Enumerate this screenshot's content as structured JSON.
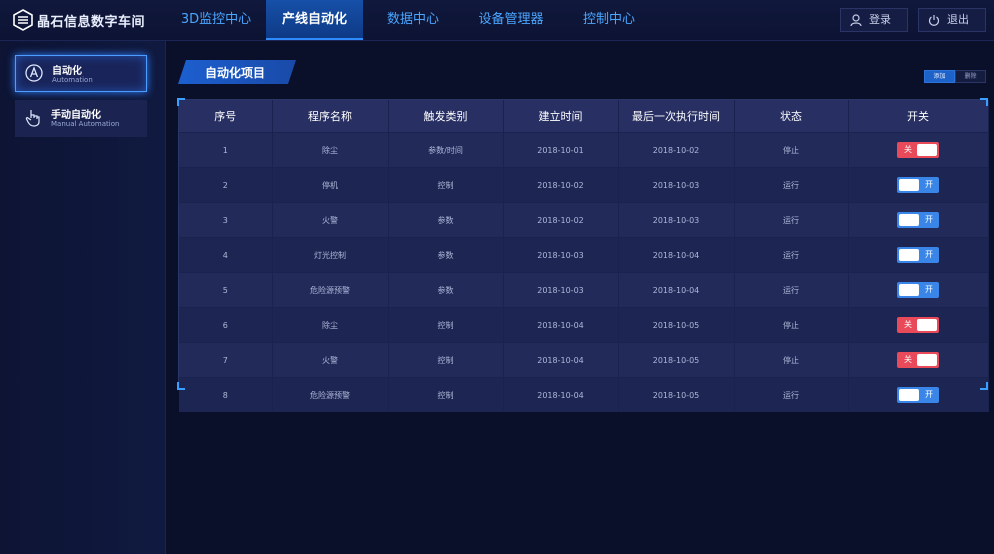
{
  "app": {
    "title": "晶石信息数字车间"
  },
  "nav": {
    "tabs": [
      {
        "label": "3D监控中心"
      },
      {
        "label": "产线自动化"
      },
      {
        "label": "数据中心"
      },
      {
        "label": "设备管理器"
      },
      {
        "label": "控制中心"
      }
    ],
    "active_index": 1
  },
  "header": {
    "login_label": "登录",
    "logout_label": "退出"
  },
  "sidebar": {
    "items": [
      {
        "title": "自动化",
        "subtitle": "Automation",
        "active": true
      },
      {
        "title": "手动自动化",
        "subtitle": "Manual Automation",
        "active": false
      }
    ]
  },
  "main": {
    "section_title": "自动化项目",
    "add_label": "添加",
    "delete_label": "删除",
    "columns": [
      "序号",
      "程序名称",
      "触发类别",
      "建立时间",
      "最后一次执行时间",
      "状态",
      "开关"
    ],
    "rows": [
      {
        "no": "1",
        "name": "除尘",
        "trigger": "参数/时间",
        "created": "2018-10-01",
        "last_run": "2018-10-02",
        "status": "停止",
        "switch": "关",
        "on": false
      },
      {
        "no": "2",
        "name": "停机",
        "trigger": "控制",
        "created": "2018-10-02",
        "last_run": "2018-10-03",
        "status": "运行",
        "switch": "开",
        "on": true
      },
      {
        "no": "3",
        "name": "火警",
        "trigger": "参数",
        "created": "2018-10-02",
        "last_run": "2018-10-03",
        "status": "运行",
        "switch": "开",
        "on": true
      },
      {
        "no": "4",
        "name": "灯光控制",
        "trigger": "参数",
        "created": "2018-10-03",
        "last_run": "2018-10-04",
        "status": "运行",
        "switch": "开",
        "on": true
      },
      {
        "no": "5",
        "name": "危险源预警",
        "trigger": "参数",
        "created": "2018-10-03",
        "last_run": "2018-10-04",
        "status": "运行",
        "switch": "开",
        "on": true
      },
      {
        "no": "6",
        "name": "除尘",
        "trigger": "控制",
        "created": "2018-10-04",
        "last_run": "2018-10-05",
        "status": "停止",
        "switch": "关",
        "on": false
      },
      {
        "no": "7",
        "name": "火警",
        "trigger": "控制",
        "created": "2018-10-04",
        "last_run": "2018-10-05",
        "status": "停止",
        "switch": "关",
        "on": false
      },
      {
        "no": "8",
        "name": "危险源预警",
        "trigger": "控制",
        "created": "2018-10-04",
        "last_run": "2018-10-05",
        "status": "运行",
        "switch": "开",
        "on": true
      }
    ]
  },
  "colors": {
    "accent": "#2f8cff",
    "switch_on": "#3a86e8",
    "switch_off": "#e84a5a"
  }
}
